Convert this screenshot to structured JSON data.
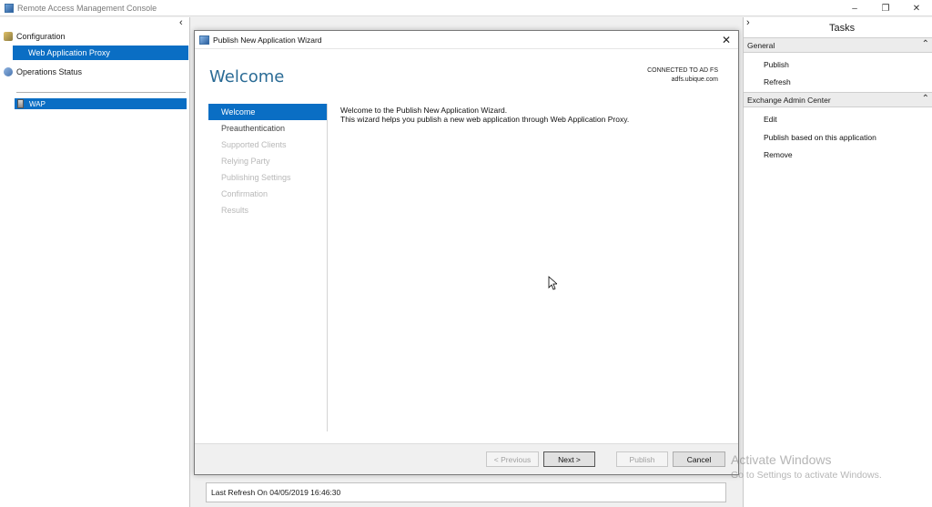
{
  "window": {
    "title": "Remote Access Management Console",
    "minimize": "–",
    "restore": "❐",
    "close": "✕"
  },
  "left_pane": {
    "collapse": "‹",
    "configuration": "Configuration",
    "web_application_proxy": "Web Application Proxy",
    "operations_status": "Operations Status",
    "server": "WAP"
  },
  "status": {
    "last_refresh": "Last Refresh On 04/05/2019 16:46:30"
  },
  "dialog": {
    "title": "Publish New Application Wizard",
    "close": "✕",
    "heading": "Welcome",
    "connected_label": "CONNECTED TO AD FS",
    "connected_host": "adfs.ubique.com",
    "steps": [
      {
        "label": "Welcome",
        "state": "active"
      },
      {
        "label": "Preauthentication",
        "state": "enabled"
      },
      {
        "label": "Supported Clients",
        "state": "disabled"
      },
      {
        "label": "Relying Party",
        "state": "disabled"
      },
      {
        "label": "Publishing Settings",
        "state": "disabled"
      },
      {
        "label": "Confirmation",
        "state": "disabled"
      },
      {
        "label": "Results",
        "state": "disabled"
      }
    ],
    "body_line1": "Welcome to the Publish New Application Wizard.",
    "body_line2": "This wizard helps you publish a new web application through Web Application Proxy.",
    "buttons": {
      "previous": "< Previous",
      "next": "Next >",
      "publish": "Publish",
      "cancel": "Cancel"
    }
  },
  "right_pane": {
    "collapse": "›",
    "title": "Tasks",
    "general": {
      "header": "General",
      "chevron": "⌃",
      "items": [
        "Publish",
        "Refresh"
      ]
    },
    "exchange": {
      "header": "Exchange Admin Center",
      "chevron": "⌃",
      "items": [
        "Edit",
        "Publish based on this application",
        "Remove"
      ]
    }
  },
  "watermark": {
    "line1": "Activate Windows",
    "line2": "Go to Settings to activate Windows."
  },
  "colors": {
    "selection": "#0a6ec4",
    "heading": "#2a6b95"
  }
}
